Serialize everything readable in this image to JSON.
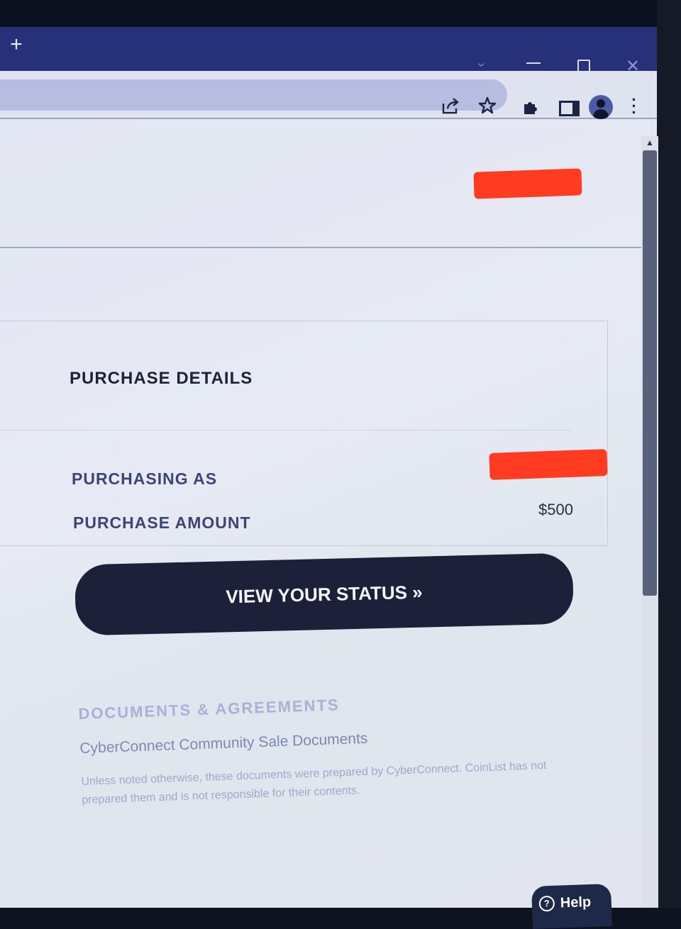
{
  "browser": {
    "new_tab_symbol": "+",
    "window_close_symbol": "✕",
    "tab_search_symbol": "⌄",
    "toolbar_icons": [
      "share-icon",
      "star-icon",
      "extensions-icon",
      "side-panel-icon",
      "profile-avatar",
      "menu-icon"
    ]
  },
  "purchase": {
    "section_title": "PURCHASE DETAILS",
    "purchasing_as_label": "PURCHASING AS",
    "purchase_amount_label": "PURCHASE AMOUNT",
    "purchase_amount_value": "$500",
    "status_button_label": "VIEW YOUR STATUS »"
  },
  "documents": {
    "title": "DOCUMENTS & AGREEMENTS",
    "link_label": "CyberConnect Community Sale Documents",
    "note": "Unless noted otherwise, these documents were prepared by CyberConnect. CoinList has not prepared them and is not responsible for their contents."
  },
  "help": {
    "label": "Help"
  },
  "colors": {
    "accent_dark": "#1c2139",
    "redaction": "#ff3b22",
    "chrome_tabstrip": "#26317a"
  }
}
